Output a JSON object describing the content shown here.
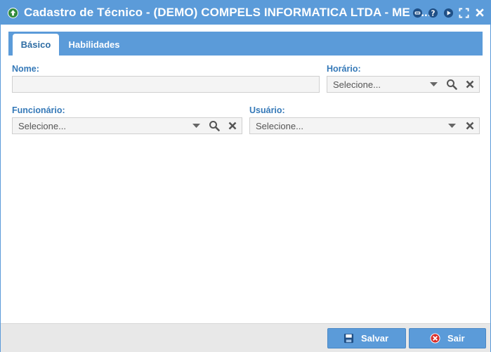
{
  "window": {
    "title": "Cadastro de Técnico - (DEMO) COMPELS INFORMATICA LTDA - ME - ...",
    "accent_color": "#5b9bd9",
    "title_icon": "up-arrow-circle-icon",
    "controls": [
      "minimize-icon",
      "help-icon",
      "play-icon",
      "maximize-icon",
      "close-icon"
    ]
  },
  "tabs": [
    {
      "label": "Básico",
      "active": true
    },
    {
      "label": "Habilidades",
      "active": false
    }
  ],
  "form": {
    "nome": {
      "label": "Nome:",
      "value": ""
    },
    "horario": {
      "label": "Horário:",
      "placeholder": "Selecione..."
    },
    "funcionario": {
      "label": "Funcionário:",
      "placeholder": "Selecione..."
    },
    "usuario": {
      "label": "Usuário:",
      "placeholder": "Selecione..."
    }
  },
  "footer": {
    "save_label": "Salvar",
    "exit_label": "Sair"
  }
}
